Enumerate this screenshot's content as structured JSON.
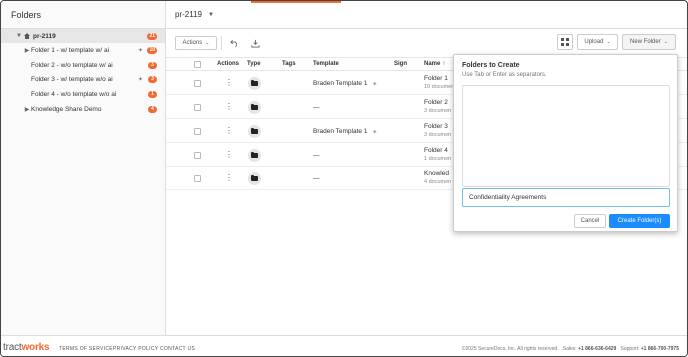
{
  "sidebar": {
    "title": "Folders",
    "tree": [
      {
        "label": "pr-2119",
        "count": "21",
        "expanded": true,
        "ai": false
      },
      {
        "label": "Folder 1 - w/ template w/ ai",
        "count": "10",
        "ai": true
      },
      {
        "label": "Folder 2 - w/o template w/ ai",
        "count": "3",
        "ai": false
      },
      {
        "label": "Folder 3 - w/ template w/o ai",
        "count": "3",
        "ai": true
      },
      {
        "label": "Folder 4 - w/o template w/o ai",
        "count": "1",
        "ai": false
      },
      {
        "label": "Knowledge Share Demo",
        "count": "4",
        "ai": false
      }
    ]
  },
  "header": {
    "breadcrumb": "pr-2119"
  },
  "toolbar": {
    "actions_label": "Actions",
    "upload_label": "Upload",
    "new_folder_label": "New Folder"
  },
  "table": {
    "columns": {
      "actions": "Actions",
      "type": "Type",
      "tags": "Tags",
      "template": "Template",
      "sign": "Sign",
      "name": "Name"
    },
    "rows": [
      {
        "template": "Braden Template 1",
        "name": "Folder 1",
        "sub": "10 documen"
      },
      {
        "template": "—",
        "name": "Folder 2",
        "sub": "3 documen"
      },
      {
        "template": "Braden Template 1",
        "name": "Folder 3",
        "sub": "3 documen"
      },
      {
        "template": "—",
        "name": "Folder 4",
        "sub": "1 documen"
      },
      {
        "template": "—",
        "name": "Knowled",
        "sub": "4 documen"
      }
    ]
  },
  "popover": {
    "title": "Folders to Create",
    "hint": "Use Tab or Enter as separators.",
    "input_value": "Confidentiality Agreements",
    "cancel_label": "Cancel",
    "create_label": "Create Folder(s)"
  },
  "footer": {
    "logo_prefix": "tract",
    "logo_accent": "works",
    "links": [
      "TERMS OF SERVICE",
      "PRIVACY POLICY",
      "CONTACT US"
    ],
    "copyright": "©2025 SecureDocs, Inc. All rights reserved.",
    "sales_label": "Sales:",
    "sales_phone": "+1 866-636-6429",
    "support_label": "Support:",
    "support_phone": "+1 866-700-7975"
  },
  "colors": {
    "accent": "#f26a33",
    "primary": "#1a8cff"
  }
}
